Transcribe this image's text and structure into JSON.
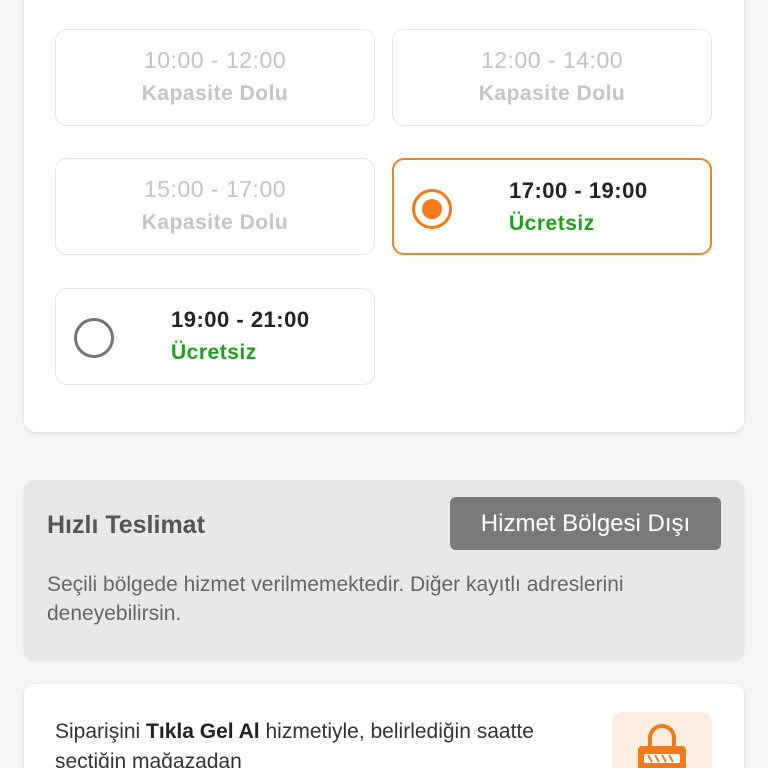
{
  "slots": [
    {
      "time": "10:00 - 12:00",
      "status": "Kapasite Dolu",
      "state": "disabled"
    },
    {
      "time": "12:00 - 14:00",
      "status": "Kapasite Dolu",
      "state": "disabled"
    },
    {
      "time": "15:00 - 17:00",
      "status": "Kapasite Dolu",
      "state": "disabled"
    },
    {
      "time": "17:00 - 19:00",
      "status": "Ücretsiz",
      "state": "selected"
    },
    {
      "time": "19:00 - 21:00",
      "status": "Ücretsiz",
      "state": "available"
    }
  ],
  "fast_delivery": {
    "title": "Hızlı Teslimat",
    "badge": "Hizmet Bölgesi Dışı",
    "description": "Seçili bölgede hizmet verilmemektedir. Diğer kayıtlı adreslerini deneyebilirsin."
  },
  "pickup": {
    "text_before": "Siparişini ",
    "text_bold": "Tıkla Gel Al",
    "text_after": " hizmetiyle, belirlediğin saatte seçtiğin mağazadan",
    "icon": "shopping-bag-icon"
  },
  "colors": {
    "accent": "#f27a1a",
    "free_green": "#20a01e",
    "badge_gray": "#7a7a7a"
  }
}
